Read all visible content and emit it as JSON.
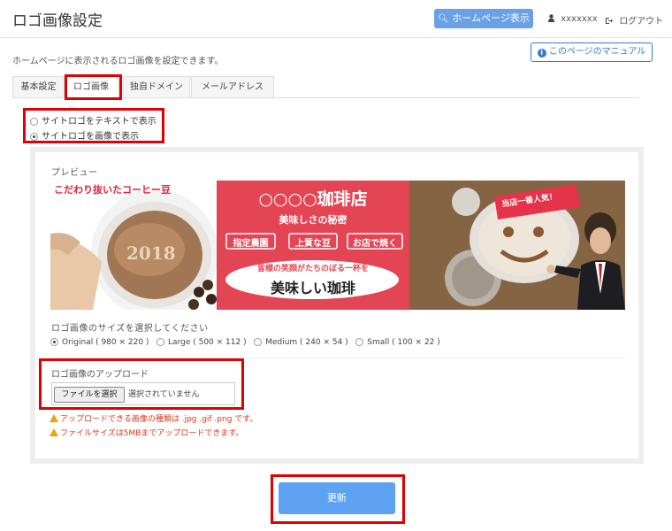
{
  "header": {
    "title": "ロゴ画像設定",
    "homepage_button": "ホームページ表示",
    "username": "xxxxxxx",
    "logout": "ログアウト"
  },
  "description": "ホームページに表示されるロゴ画像を設定できます。",
  "manual_button": "このページのマニュアル",
  "tabs": [
    {
      "label": "基本設定"
    },
    {
      "label": "ロゴ画像"
    },
    {
      "label": "独自ドメイン"
    },
    {
      "label": "メールアドレス"
    }
  ],
  "logo_mode": {
    "options": [
      "サイトロゴをテキストで表示",
      "サイトロゴを画像で表示"
    ],
    "selected": 1
  },
  "preview": {
    "label": "プレビュー",
    "banner": {
      "left_caption": "こだわり抜いたコーヒー豆",
      "cup_year": "2018",
      "shop_name": "○○○○珈琲店",
      "secret": "美味しさの秘密",
      "tags": [
        "指定農園",
        "上質な豆",
        "お店で焼く"
      ],
      "curve_text": "皆様の笑顔がたちのぼる一杯を",
      "tagline": "美味しい珈琲",
      "badge": "当店一番人気！"
    }
  },
  "size": {
    "label": "ロゴ画像のサイズを選択してください",
    "options": [
      "Original ( 980 × 220 )",
      "Large ( 500 × 112 )",
      "Medium ( 240 × 54 )",
      "Small ( 100 × 22 )"
    ],
    "selected": 0
  },
  "upload": {
    "label": "ロゴ画像のアップロード",
    "file_button": "ファイルを選択",
    "no_file": "選択されていません",
    "warnings": [
      "アップロードできる画像の種類は .jpg .gif .png です。",
      "ファイルサイズは5MBまでアップロードできます。"
    ]
  },
  "update_button": "更新",
  "colors": {
    "accent": "#5ea3f1",
    "highlight_border": "#e00000",
    "banner_red": "#e44554",
    "warning": "#d9361e"
  }
}
